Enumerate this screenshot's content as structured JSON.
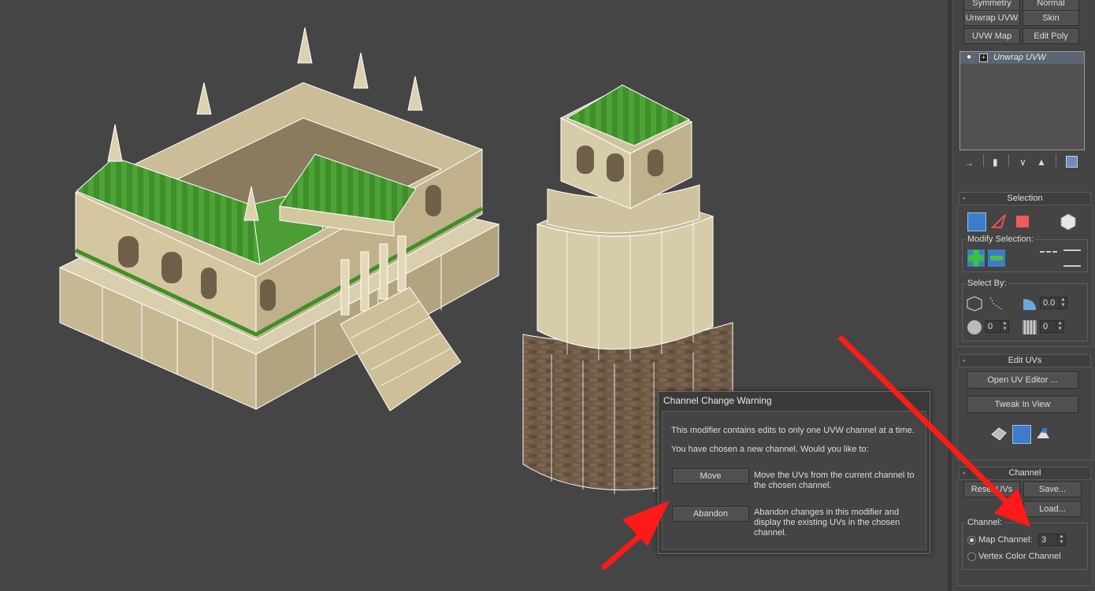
{
  "modifier_buttons": {
    "symmetry": "Symmetry",
    "normal": "Normal",
    "unwrap_uvw": "Unwrap UVW",
    "skin": "Skin",
    "uvw_map": "UVW Map",
    "edit_poly": "Edit Poly"
  },
  "modifier_stack": {
    "items": [
      "Unwrap UVW"
    ]
  },
  "selection_rollout": {
    "title": "Selection",
    "modify_selection_label": "Modify Selection:",
    "select_by_label": "Select By:",
    "angle_value": "0.0",
    "spin1_value": "0",
    "spin2_value": "0"
  },
  "edit_uvs_rollout": {
    "title": "Edit UVs",
    "open_uv_editor": "Open UV Editor ...",
    "tweak_in_view": "Tweak In View"
  },
  "channel_rollout": {
    "title": "Channel",
    "reset_uvs": "Reset UVs",
    "save": "Save...",
    "load": "Load...",
    "group_label": "Channel:",
    "map_channel_label": "Map Channel:",
    "map_channel_value": "3",
    "vertex_color_label": "Vertex Color Channel"
  },
  "dialog": {
    "title": "Channel Change Warning",
    "line1": "This modifier contains edits to only one UVW channel at a time.",
    "line2": "You have chosen a new channel. Would you like to:",
    "move_label": "Move",
    "move_desc": "Move the UVs from the current channel to the chosen channel.",
    "abandon_label": "Abandon",
    "abandon_desc": "Abandon changes in this modifier and display the existing UVs in the chosen channel."
  },
  "colors": {
    "annotation_arrow": "#ff1a1a",
    "roof_green": "#3f8f2a",
    "stone": "#cbbf9c",
    "selection_blue": "#3d7cc9"
  }
}
